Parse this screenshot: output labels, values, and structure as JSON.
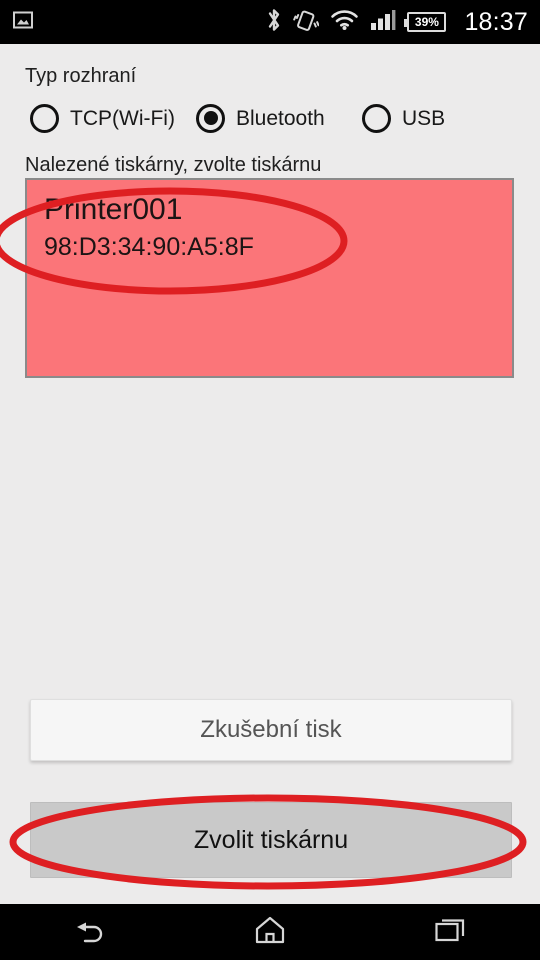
{
  "status_bar": {
    "notification_icon": "photo-icon",
    "icons": [
      {
        "name": "bluetooth-icon"
      },
      {
        "name": "vibrate-icon"
      },
      {
        "name": "wifi-icon"
      },
      {
        "name": "cellular-signal-icon"
      }
    ],
    "battery_percent": "39%",
    "clock": "18:37"
  },
  "form": {
    "interface_type_label": "Typ rozhraní",
    "radio_options": [
      {
        "label": "TCP(Wi-Fi)",
        "selected": false
      },
      {
        "label": "Bluetooth",
        "selected": true
      },
      {
        "label": "USB",
        "selected": false
      }
    ],
    "found_printers_label": "Nalezené tiskárny, zvolte tiskárnu",
    "printers": [
      {
        "name": "Printer001",
        "mac": "98:D3:34:90:A5:8F",
        "selected": true
      }
    ]
  },
  "buttons": {
    "test_print": "Zkušební tisk",
    "select_printer": "Zvolit tiskárnu"
  },
  "navigation": {
    "back": "back-icon",
    "home": "home-icon",
    "recents": "recents-icon"
  },
  "colors": {
    "list_selected_background": "#FB7579",
    "annotation": "#DE1F22",
    "page_background": "#ECEBEB",
    "select_button": "#C9C9C9",
    "status_bar": "#000000"
  }
}
